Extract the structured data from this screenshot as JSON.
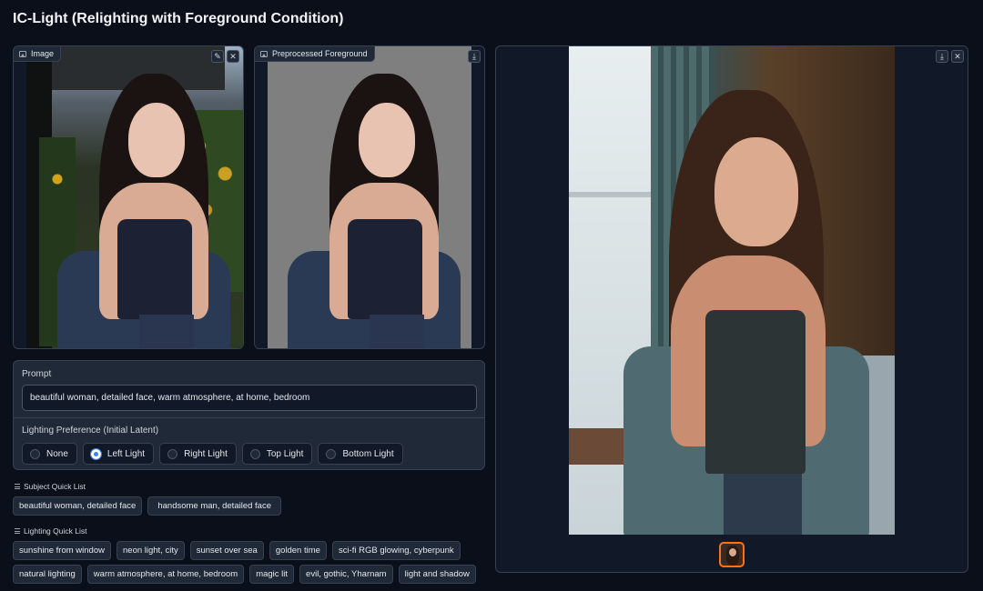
{
  "app": {
    "title": "IC-Light (Relighting with Foreground Condition)"
  },
  "image_panel": {
    "label": "Image"
  },
  "preprocessed_panel": {
    "label": "Preprocessed Foreground"
  },
  "icons": {
    "edit": "pencil-icon",
    "close": "close-icon",
    "download": "download-icon",
    "image": "image-icon"
  },
  "prompt": {
    "label": "Prompt",
    "value": "beautiful woman, detailed face, warm atmosphere, at home, bedroom"
  },
  "lighting": {
    "label": "Lighting Preference (Initial Latent)",
    "options": [
      "None",
      "Left Light",
      "Right Light",
      "Top Light",
      "Bottom Light"
    ],
    "selected": "Left Light"
  },
  "subject_quick_list": {
    "title": "Subject Quick List",
    "items": [
      "beautiful woman, detailed face",
      "handsome man, detailed face"
    ]
  },
  "lighting_quick_list": {
    "title": "Lighting Quick List",
    "row1": [
      "sunshine from window",
      "neon light, city",
      "sunset over sea",
      "golden time",
      "sci-fi RGB glowing, cyberpunk"
    ],
    "row2": [
      "natural lighting",
      "warm atmosphere, at home, bedroom",
      "magic lit",
      "evil, gothic, Yharnam",
      "light and shadow"
    ]
  },
  "colors": {
    "accent": "#3b82f6",
    "thumb_border": "#f97316",
    "background": "#0b0f19"
  }
}
